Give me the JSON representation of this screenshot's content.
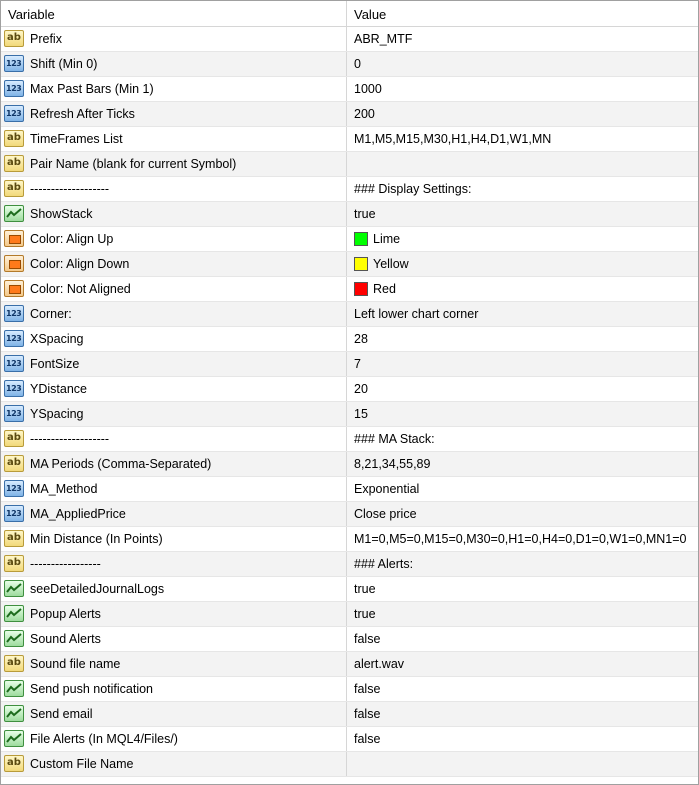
{
  "header": {
    "variable_label": "Variable",
    "value_label": "Value"
  },
  "rows": [
    {
      "icon": "ab-icon",
      "name": "Prefix",
      "value": "ABR_MTF"
    },
    {
      "icon": "numeric-icon",
      "name": "Shift (Min 0)",
      "value": "0"
    },
    {
      "icon": "numeric-icon",
      "name": "Max Past Bars (Min 1)",
      "value": "1000"
    },
    {
      "icon": "numeric-icon",
      "name": "Refresh After Ticks",
      "value": "200"
    },
    {
      "icon": "ab-icon",
      "name": "TimeFrames List",
      "value": "M1,M5,M15,M30,H1,H4,D1,W1,MN"
    },
    {
      "icon": "ab-icon",
      "name": "Pair Name (blank for current Symbol)",
      "value": ""
    },
    {
      "icon": "ab-icon",
      "name": "-------------------",
      "value": "### Display Settings:"
    },
    {
      "icon": "bool-icon",
      "name": "ShowStack",
      "value": "true"
    },
    {
      "icon": "color-icon",
      "name": "Color: Align Up",
      "value": "Lime",
      "swatch": "#00ff00"
    },
    {
      "icon": "color-icon",
      "name": "Color: Align Down",
      "value": "Yellow",
      "swatch": "#ffff00"
    },
    {
      "icon": "color-icon",
      "name": "Color: Not Aligned",
      "value": "Red",
      "swatch": "#ff0000"
    },
    {
      "icon": "numeric-icon",
      "name": "Corner:",
      "value": "Left lower chart corner"
    },
    {
      "icon": "numeric-icon",
      "name": "XSpacing",
      "value": "28"
    },
    {
      "icon": "numeric-icon",
      "name": "FontSize",
      "value": "7"
    },
    {
      "icon": "numeric-icon",
      "name": "YDistance",
      "value": "20"
    },
    {
      "icon": "numeric-icon",
      "name": "YSpacing",
      "value": "15"
    },
    {
      "icon": "ab-icon",
      "name": "-------------------",
      "value": "### MA Stack:"
    },
    {
      "icon": "ab-icon",
      "name": "MA Periods (Comma-Separated)",
      "value": "8,21,34,55,89"
    },
    {
      "icon": "numeric-icon",
      "name": "MA_Method",
      "value": "Exponential"
    },
    {
      "icon": "numeric-icon",
      "name": "MA_AppliedPrice",
      "value": "Close price"
    },
    {
      "icon": "ab-icon",
      "name": "Min Distance (In Points)",
      "value": "M1=0,M5=0,M15=0,M30=0,H1=0,H4=0,D1=0,W1=0,MN1=0"
    },
    {
      "icon": "ab-icon",
      "name": "-----------------",
      "value": "### Alerts:"
    },
    {
      "icon": "bool-icon",
      "name": "seeDetailedJournalLogs",
      "value": "true"
    },
    {
      "icon": "bool-icon",
      "name": "Popup Alerts",
      "value": "true"
    },
    {
      "icon": "bool-icon",
      "name": "Sound Alerts",
      "value": "false"
    },
    {
      "icon": "ab-icon",
      "name": "Sound file name",
      "value": "alert.wav"
    },
    {
      "icon": "bool-icon",
      "name": "Send push notification",
      "value": "false"
    },
    {
      "icon": "bool-icon",
      "name": "Send email",
      "value": "false"
    },
    {
      "icon": "bool-icon",
      "name": "File Alerts (In MQL4/Files/)",
      "value": "false"
    },
    {
      "icon": "ab-icon",
      "name": "Custom File Name",
      "value": ""
    }
  ]
}
